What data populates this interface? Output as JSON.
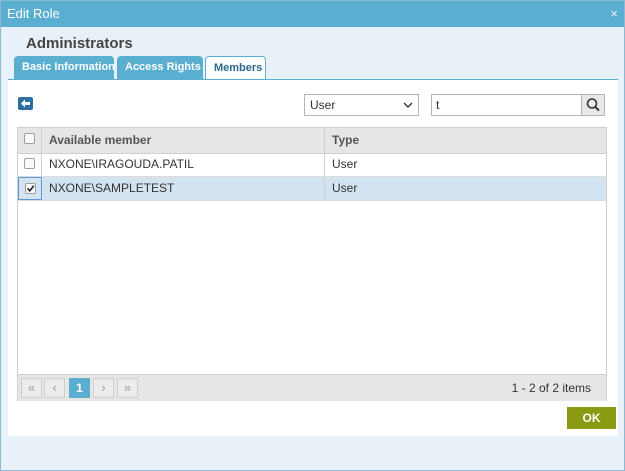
{
  "dialog": {
    "title": "Edit Role",
    "close_glyph": "×",
    "role_name": "Administrators"
  },
  "tabs": [
    {
      "label": "Basic Information",
      "active": false
    },
    {
      "label": "Access Rights",
      "active": false
    },
    {
      "label": "Members",
      "active": true
    }
  ],
  "toolbar": {
    "back_icon": "arrow-left-icon",
    "type_select": {
      "value": "User",
      "chevron": "⌄"
    },
    "search": {
      "value": "t",
      "icon": "magnifier-icon"
    }
  },
  "grid": {
    "columns": [
      "Available member",
      "Type"
    ],
    "rows": [
      {
        "member": "NXONE\\IRAGOUDA.PATIL",
        "type": "User",
        "checked": false
      },
      {
        "member": "NXONE\\SAMPLETEST",
        "type": "User",
        "checked": true
      }
    ]
  },
  "pager": {
    "first": "«",
    "prev": "‹",
    "current": "1",
    "next": "›",
    "last": "»",
    "info": "1 - 2 of 2 items"
  },
  "actions": {
    "ok_label": "OK"
  },
  "colors": {
    "titlebar": "#5aaed0",
    "ok_button": "#8a9a12",
    "selected_row": "#d3e3ef"
  }
}
